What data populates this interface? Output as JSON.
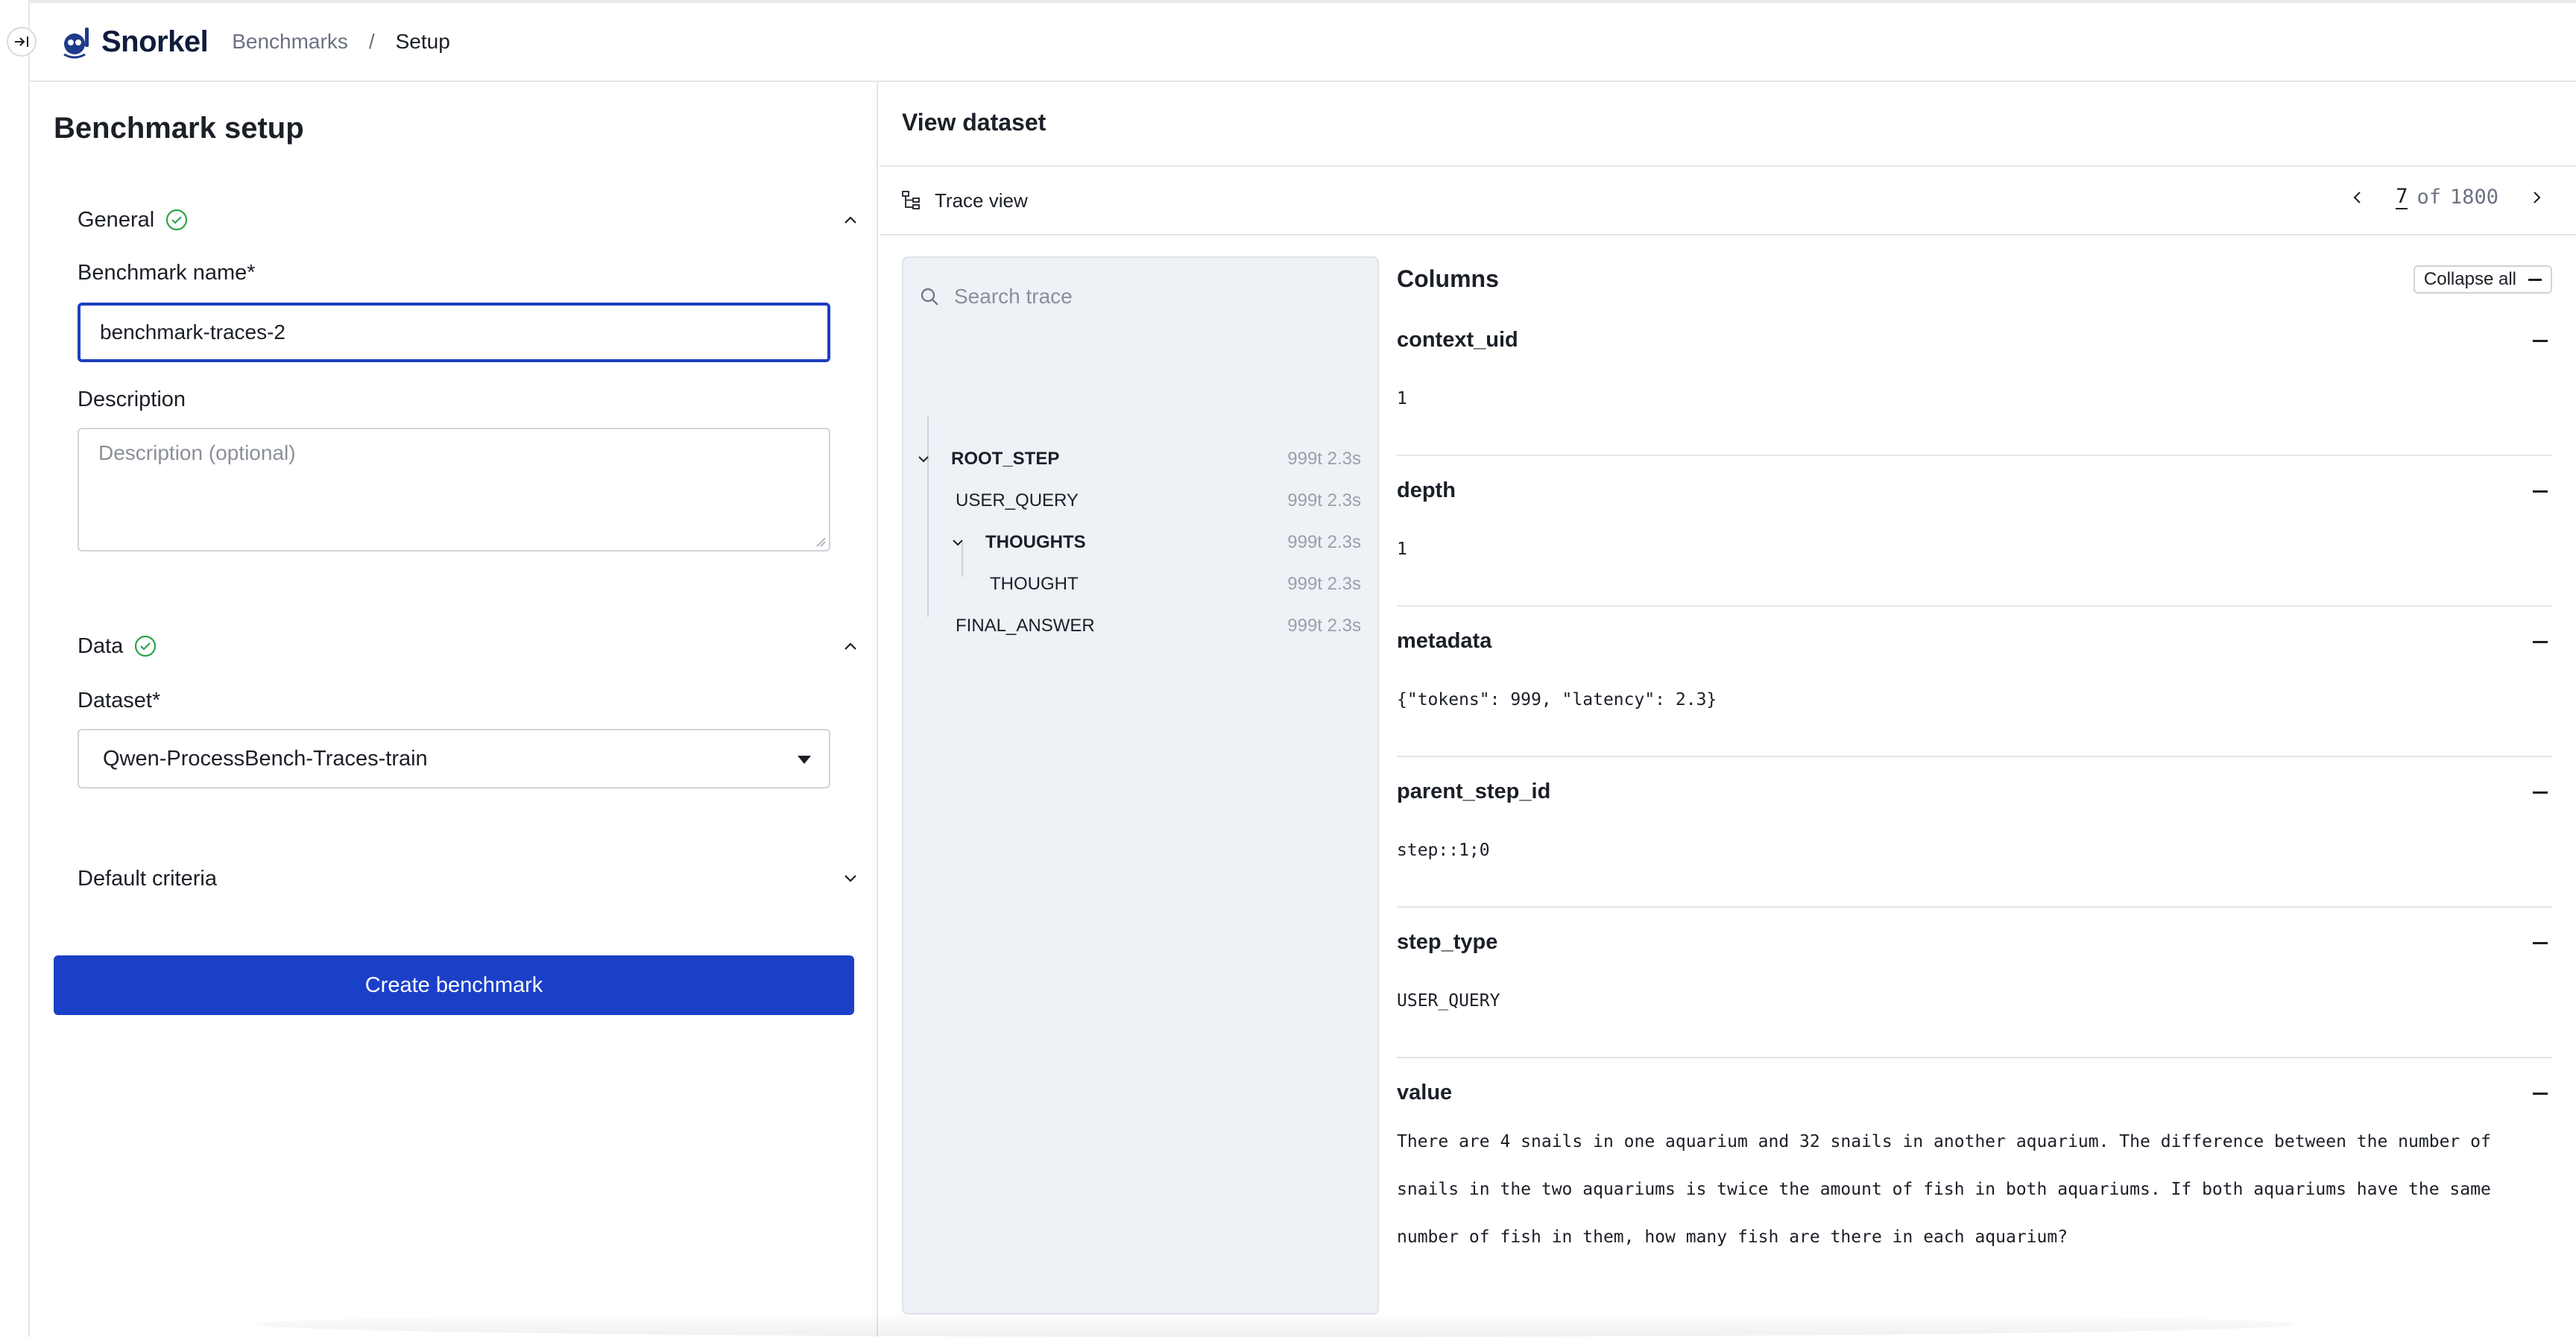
{
  "brand": {
    "name": "Snorkel"
  },
  "breadcrumb": {
    "item1": "Benchmarks",
    "separator": "/",
    "item2": "Setup"
  },
  "setup": {
    "title": "Benchmark setup",
    "general": {
      "title": "General",
      "name_label": "Benchmark name*",
      "name_value": "benchmark-traces-2",
      "description_label": "Description",
      "description_placeholder": "Description (optional)"
    },
    "data": {
      "title": "Data",
      "dataset_label": "Dataset*",
      "dataset_value": "Qwen-ProcessBench-Traces-train"
    },
    "criteria": {
      "title": "Default criteria"
    },
    "create_button": "Create benchmark"
  },
  "dataset_view": {
    "title": "View dataset",
    "trace_view_label": "Trace view",
    "pager": {
      "current": "7",
      "of_label": "of",
      "total": "1800"
    },
    "search_placeholder": "Search trace",
    "tree": [
      {
        "name": "ROOT_STEP",
        "meta": "999t 2.3s"
      },
      {
        "name": "USER_QUERY",
        "meta": "999t 2.3s"
      },
      {
        "name": "THOUGHTS",
        "meta": "999t 2.3s"
      },
      {
        "name": "THOUGHT",
        "meta": "999t 2.3s"
      },
      {
        "name": "FINAL_ANSWER",
        "meta": "999t 2.3s"
      }
    ],
    "columns_title": "Columns",
    "collapse_all": "Collapse all",
    "columns": [
      {
        "name": "context_uid",
        "value": "1"
      },
      {
        "name": "depth",
        "value": "1"
      },
      {
        "name": "metadata",
        "value": "{\"tokens\": 999, \"latency\": 2.3}"
      },
      {
        "name": "parent_step_id",
        "value": "step::1;0"
      },
      {
        "name": "step_type",
        "value": "USER_QUERY"
      },
      {
        "name": "value",
        "value_lines": [
          "There are 4 snails in one aquarium and 32 snails in another aquarium. The difference between the number of",
          "snails in the two aquariums is twice the amount of fish in both aquariums. If both aquariums have the same",
          "number of fish in them, how many fish are there in each aquarium?"
        ]
      }
    ]
  },
  "colors": {
    "accent": "#1b40c8",
    "success": "#2fa34a",
    "border": "#e4e6ea"
  }
}
